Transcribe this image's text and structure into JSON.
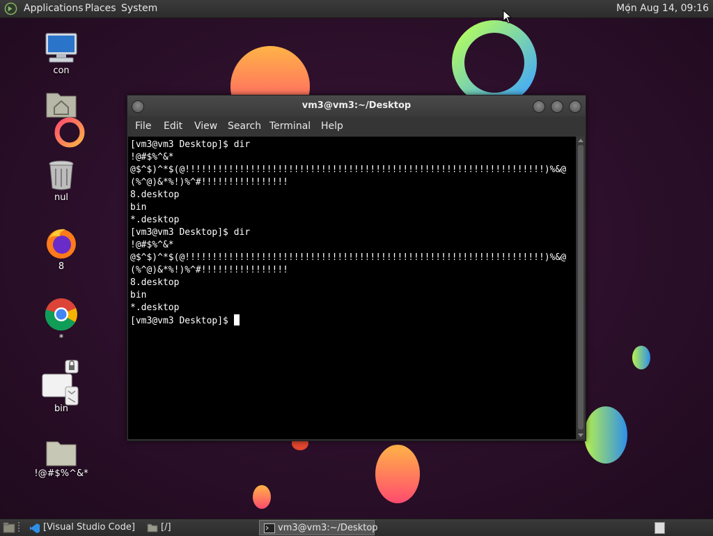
{
  "top_panel": {
    "menus": [
      "Applications",
      "Places",
      "System"
    ],
    "clock": "Mon Aug 14, 09:16"
  },
  "desktop_icons": [
    {
      "label": "con",
      "icon": "computer-icon"
    },
    {
      "label": "",
      "icon": "home-folder-icon"
    },
    {
      "label": "nul",
      "icon": "trash-icon"
    },
    {
      "label": "8",
      "icon": "firefox-icon"
    },
    {
      "label": "*",
      "icon": "chrome-icon"
    },
    {
      "label": "bin",
      "icon": "locked-file-icon"
    },
    {
      "label": "!@#$%^&*",
      "icon": "folder-icon"
    }
  ],
  "terminal": {
    "title": "vm3@vm3:~/Desktop",
    "menu": [
      "File",
      "Edit",
      "View",
      "Search",
      "Terminal",
      "Help"
    ],
    "lines": [
      "[vm3@vm3 Desktop]$ dir",
      "!@#$%^&*",
      "@$^$)^*$(@!!!!!!!!!!!!!!!!!!!!!!!!!!!!!!!!!!!!!!!!!!!!!!!!!!!!!!!!!!!!!!!!!!)%&@",
      "(%^@)&*%!)%^#!!!!!!!!!!!!!!!!",
      "8.desktop",
      "bin",
      "*.desktop",
      "[vm3@vm3 Desktop]$ dir",
      "!@#$%^&*",
      "@$^$)^*$(@!!!!!!!!!!!!!!!!!!!!!!!!!!!!!!!!!!!!!!!!!!!!!!!!!!!!!!!!!!!!!!!!!!)%&@",
      "(%^@)&*%!)%^#!!!!!!!!!!!!!!!!",
      "8.desktop",
      "bin",
      "*.desktop"
    ],
    "prompt": "[vm3@vm3 Desktop]$ "
  },
  "taskbar": {
    "tasks": [
      {
        "label": "[Visual Studio Code]",
        "icon": "vscode-icon"
      },
      {
        "label": "[/]",
        "icon": "folder-icon"
      },
      {
        "label": "vm3@vm3:~/Desktop",
        "icon": "terminal-icon"
      }
    ]
  },
  "colors": {
    "wallpaper": "#2b0f2a",
    "terminal_bg": "#000000",
    "panel": "#333333"
  }
}
